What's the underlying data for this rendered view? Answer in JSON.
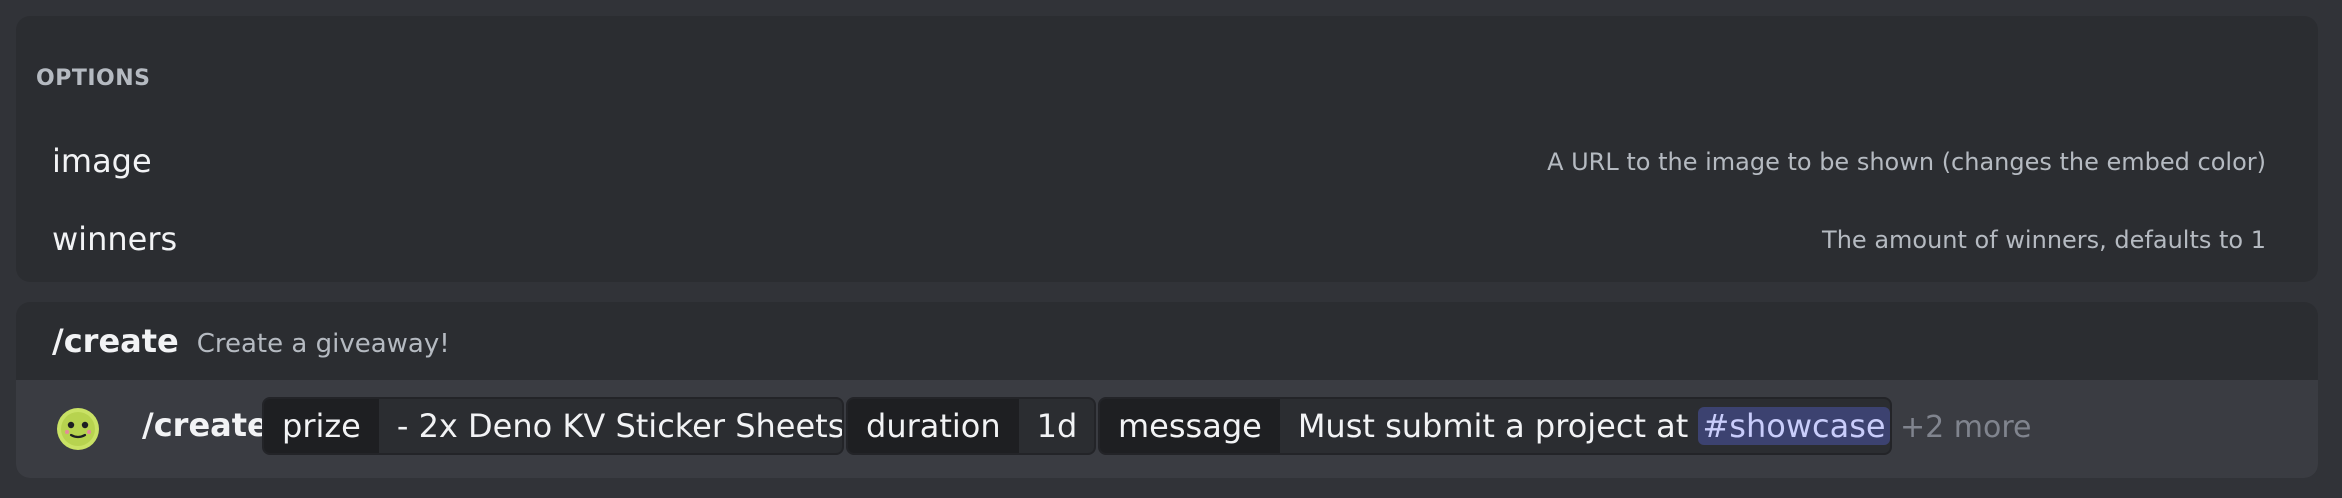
{
  "options": {
    "header": "OPTIONS",
    "items": [
      {
        "name": "image",
        "description": "A URL to the image to be shown (changes the embed color)"
      },
      {
        "name": "winners",
        "description": "The amount of winners, defaults to 1"
      }
    ]
  },
  "command": {
    "name": "/create",
    "description": "Create a giveaway!",
    "input": {
      "command": "/create",
      "params": [
        {
          "name": "prize",
          "value": "- 2x Deno KV Sticker Sheets"
        },
        {
          "name": "duration",
          "value": "1d"
        },
        {
          "name": "message",
          "value_prefix": "Must submit a project at",
          "mention": "#showcase",
          "value_suffix": "!"
        }
      ],
      "more": "+2 more"
    },
    "app_icon": "deno-app-icon"
  },
  "colors": {
    "background": "#313338",
    "panel": "#2b2d31",
    "row_highlight": "#3a3c42",
    "mention_bg": "#3c4270",
    "mention_text": "#c9cdfb"
  }
}
